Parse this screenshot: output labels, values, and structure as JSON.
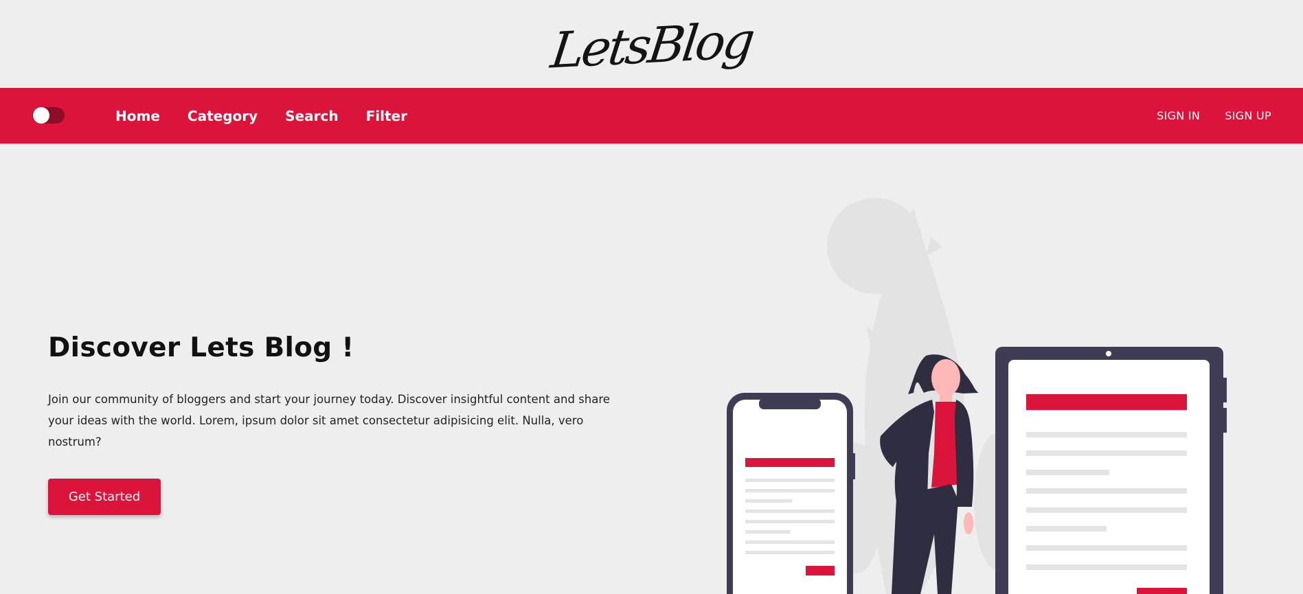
{
  "brand": {
    "logo_text": "LetsBlog"
  },
  "nav": {
    "theme_toggle": "off",
    "links": [
      "Home",
      "Category",
      "Search",
      "Filter"
    ],
    "auth": {
      "sign_in": "SIGN IN",
      "sign_up": "SIGN UP"
    }
  },
  "hero": {
    "title": "Discover Lets Blog !",
    "description": "Join our community of bloggers and start your journey today. Discover insightful content and share your ideas with the world. Lorem, ipsum dolor sit amet consectetur adipisicing elit. Nulla, vero nostrum?",
    "cta_label": "Get Started"
  },
  "colors": {
    "accent": "#dc143c",
    "background": "#eeeeee",
    "device_frame": "#3f3d56"
  }
}
